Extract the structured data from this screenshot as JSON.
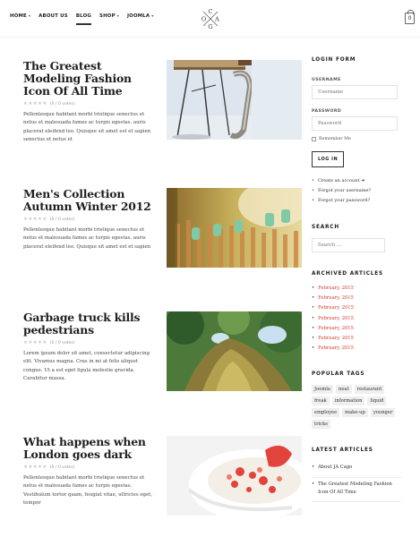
{
  "nav": {
    "items": [
      {
        "label": "HOME",
        "caret": "▾"
      },
      {
        "label": "ABOUT US",
        "caret": ""
      },
      {
        "label": "BLOG",
        "caret": ""
      },
      {
        "label": "SHOP",
        "caret": "▾"
      },
      {
        "label": "JOOMLA",
        "caret": "▾"
      }
    ],
    "active": "BLOG",
    "logo_letters": [
      "C",
      "O",
      "A",
      "G"
    ],
    "cart_count": "0"
  },
  "articles": [
    {
      "title": "The Greatest Modeling Fashion Icon Of All Time",
      "stars": "★★★★★",
      "votes": "(0 / 0 votes)",
      "excerpt": "Pellentesque habitant morbi tristique senectus et netus et malesuada fames ac turpis egestas. auris placerat eleifend leo. Quisque sit amet est et sapien senectus et netus et",
      "image": "chairs"
    },
    {
      "title": "Men's Collection Autumn Winter 2012",
      "stars": "★★★★★",
      "votes": "(0 / 0 votes)",
      "excerpt": "Pellentesque habitant morbi tristique senectus et netus et malesuada fames ac turpis egestas. auris placerat eleifend leo. Quisque sit amet est et sapien",
      "image": "fence"
    },
    {
      "title": "Garbage truck kills pedestrians",
      "stars": "★★★★★",
      "votes": "(0 / 0 votes)",
      "excerpt": "Lorem ipsum dolor sit amet, consectetur adipiscing elit. Vivamus magna. Cras in mi at felis aliquet congue. Ut a est eget ligula molestie gravida. Curabitur massa.",
      "image": "tree"
    },
    {
      "title": "What happens when London goes dark",
      "stars": "★★★★★",
      "votes": "(0 / 0 votes)",
      "excerpt": "Pellentesque habitant morbi tristique senectus et netus et malesuada fames ac turpis egestas. Vestibulum tortor quam, feugiat vitae, ultricies eget, tempor",
      "image": "strawberry-bowl"
    }
  ],
  "sidebar": {
    "login": {
      "heading": "LOGIN FORM",
      "username_label": "USERNAME",
      "username_placeholder": "Username",
      "password_label": "PASSWORD",
      "password_placeholder": "Password",
      "remember": "Remember Me",
      "button": "LOG IN",
      "links": [
        "Create an account ➔",
        "Forgot your username?",
        "Forgot your password?"
      ]
    },
    "search": {
      "heading": "SEARCH",
      "placeholder": "Search ..."
    },
    "archive": {
      "heading": "ARCHIVED ARTICLES",
      "items": [
        "February, 2015",
        "February, 2015",
        "February, 2015",
        "February, 2015",
        "February, 2015",
        "February, 2015",
        "February, 2015"
      ]
    },
    "tags": {
      "heading": "POPULAR TAGS",
      "items": [
        "Joomla",
        "neat",
        "restaurant",
        "freak",
        "information",
        "liquid",
        "employee",
        "make-up",
        "younger",
        "tricks"
      ]
    },
    "latest": {
      "heading": "LATEST ARTICLES",
      "items": [
        "About JA Cago",
        "The Greatest Modeling Fashion Icon Of All Time"
      ]
    }
  },
  "colors": {
    "accent_red": "#d8372b",
    "text_dark": "#1e1e1e"
  }
}
